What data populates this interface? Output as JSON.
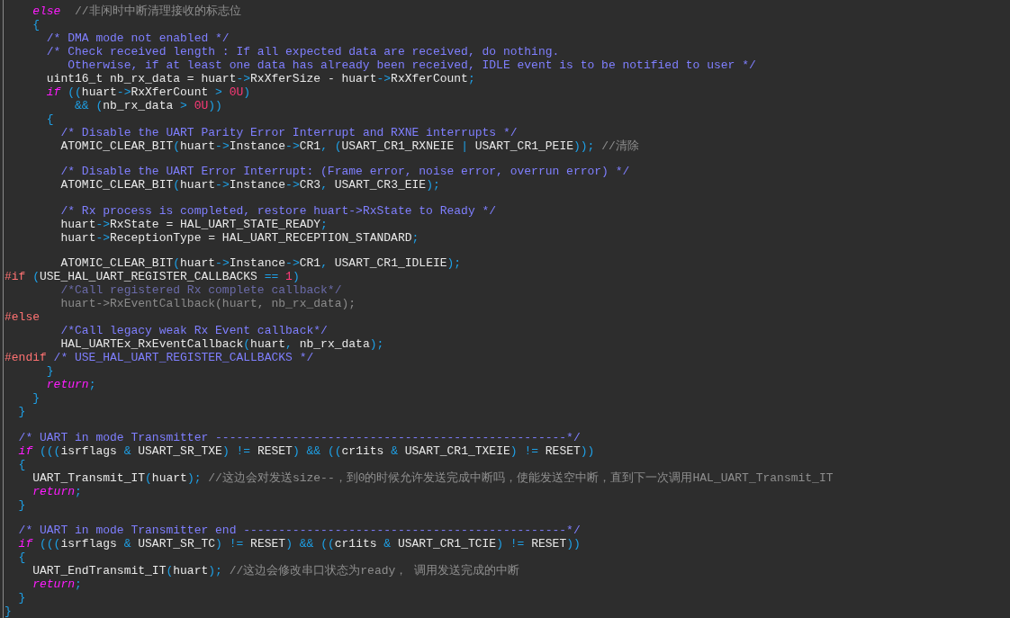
{
  "editor": {
    "lines": [
      {
        "kind": "code",
        "tokens": [
          {
            "kind": "keyword",
            "text": "    else"
          },
          {
            "kind": "note",
            "text": "  //非闲时中断清理接收的标志位"
          }
        ]
      },
      {
        "kind": "code",
        "tokens": [
          {
            "kind": "punct",
            "text": "    {"
          }
        ]
      },
      {
        "kind": "code",
        "tokens": [
          {
            "kind": "comment",
            "text": "      /* DMA mode not enabled */"
          }
        ]
      },
      {
        "kind": "code",
        "tokens": [
          {
            "kind": "comment",
            "text": "      /* Check received length : If all expected data are received, do nothing."
          }
        ]
      },
      {
        "kind": "code",
        "tokens": [
          {
            "kind": "comment",
            "text": "         Otherwise, if at least one data has already been received, IDLE event is to be notified to user */"
          }
        ]
      },
      {
        "kind": "code",
        "tokens": [
          {
            "kind": "plain",
            "text": "      uint16_t nb_rx_data = huart"
          },
          {
            "kind": "punct",
            "text": "->"
          },
          {
            "kind": "plain",
            "text": "RxXferSize - huart"
          },
          {
            "kind": "punct",
            "text": "->"
          },
          {
            "kind": "plain",
            "text": "RxXferCount"
          },
          {
            "kind": "punct",
            "text": ";"
          }
        ]
      },
      {
        "kind": "code",
        "tokens": [
          {
            "kind": "keyword",
            "text": "      if"
          },
          {
            "kind": "punct",
            "text": " (("
          },
          {
            "kind": "plain",
            "text": "huart"
          },
          {
            "kind": "punct",
            "text": "->"
          },
          {
            "kind": "plain",
            "text": "RxXferCount "
          },
          {
            "kind": "punct",
            "text": ">"
          },
          {
            "kind": "number",
            "text": " 0U"
          },
          {
            "kind": "punct",
            "text": ")"
          }
        ]
      },
      {
        "kind": "code",
        "tokens": [
          {
            "kind": "punct",
            "text": "          && ("
          },
          {
            "kind": "plain",
            "text": "nb_rx_data "
          },
          {
            "kind": "punct",
            "text": ">"
          },
          {
            "kind": "number",
            "text": " 0U"
          },
          {
            "kind": "punct",
            "text": "))"
          }
        ]
      },
      {
        "kind": "code",
        "tokens": [
          {
            "kind": "punct",
            "text": "      {"
          }
        ]
      },
      {
        "kind": "code",
        "tokens": [
          {
            "kind": "comment",
            "text": "        /* Disable the UART Parity Error Interrupt and RXNE interrupts */"
          }
        ]
      },
      {
        "kind": "code",
        "tokens": [
          {
            "kind": "plain",
            "text": "        ATOMIC_CLEAR_BIT"
          },
          {
            "kind": "punct",
            "text": "("
          },
          {
            "kind": "plain",
            "text": "huart"
          },
          {
            "kind": "punct",
            "text": "->"
          },
          {
            "kind": "plain",
            "text": "Instance"
          },
          {
            "kind": "punct",
            "text": "->"
          },
          {
            "kind": "plain",
            "text": "CR1"
          },
          {
            "kind": "punct",
            "text": ", ("
          },
          {
            "kind": "plain",
            "text": "USART_CR1_RXNEIE "
          },
          {
            "kind": "punct",
            "text": "|"
          },
          {
            "kind": "plain",
            "text": " USART_CR1_PEIE"
          },
          {
            "kind": "punct",
            "text": "));"
          },
          {
            "kind": "note",
            "text": " //清除"
          }
        ]
      },
      {
        "kind": "blank"
      },
      {
        "kind": "code",
        "tokens": [
          {
            "kind": "comment",
            "text": "        /* Disable the UART Error Interrupt: (Frame error, noise error, overrun error) */"
          }
        ]
      },
      {
        "kind": "code",
        "tokens": [
          {
            "kind": "plain",
            "text": "        ATOMIC_CLEAR_BIT"
          },
          {
            "kind": "punct",
            "text": "("
          },
          {
            "kind": "plain",
            "text": "huart"
          },
          {
            "kind": "punct",
            "text": "->"
          },
          {
            "kind": "plain",
            "text": "Instance"
          },
          {
            "kind": "punct",
            "text": "->"
          },
          {
            "kind": "plain",
            "text": "CR3"
          },
          {
            "kind": "punct",
            "text": ", "
          },
          {
            "kind": "plain",
            "text": "USART_CR3_EIE"
          },
          {
            "kind": "punct",
            "text": ");"
          }
        ]
      },
      {
        "kind": "blank"
      },
      {
        "kind": "code",
        "tokens": [
          {
            "kind": "comment",
            "text": "        /* Rx process is completed, restore huart->RxState to Ready */"
          }
        ]
      },
      {
        "kind": "code",
        "tokens": [
          {
            "kind": "plain",
            "text": "        huart"
          },
          {
            "kind": "punct",
            "text": "->"
          },
          {
            "kind": "plain",
            "text": "RxState = HAL_UART_STATE_READY"
          },
          {
            "kind": "punct",
            "text": ";"
          }
        ]
      },
      {
        "kind": "code",
        "tokens": [
          {
            "kind": "plain",
            "text": "        huart"
          },
          {
            "kind": "punct",
            "text": "->"
          },
          {
            "kind": "plain",
            "text": "ReceptionType = HAL_UART_RECEPTION_STANDARD"
          },
          {
            "kind": "punct",
            "text": ";"
          }
        ]
      },
      {
        "kind": "blank"
      },
      {
        "kind": "code",
        "tokens": [
          {
            "kind": "plain",
            "text": "        ATOMIC_CLEAR_BIT"
          },
          {
            "kind": "punct",
            "text": "("
          },
          {
            "kind": "plain",
            "text": "huart"
          },
          {
            "kind": "punct",
            "text": "->"
          },
          {
            "kind": "plain",
            "text": "Instance"
          },
          {
            "kind": "punct",
            "text": "->"
          },
          {
            "kind": "plain",
            "text": "CR1"
          },
          {
            "kind": "punct",
            "text": ", "
          },
          {
            "kind": "plain",
            "text": "USART_CR1_IDLEIE"
          },
          {
            "kind": "punct",
            "text": ");"
          }
        ]
      },
      {
        "kind": "code",
        "tokens": [
          {
            "kind": "directive",
            "text": "#if"
          },
          {
            "kind": "punct",
            "text": " ("
          },
          {
            "kind": "plain",
            "text": "USE_HAL_UART_REGISTER_CALLBACKS "
          },
          {
            "kind": "punct",
            "text": "=="
          },
          {
            "kind": "number",
            "text": " 1"
          },
          {
            "kind": "punct",
            "text": ")"
          }
        ]
      },
      {
        "kind": "code",
        "tokens": [
          {
            "kind": "inactive_comment",
            "text": "        /*Call registered Rx complete callback*/"
          }
        ]
      },
      {
        "kind": "code",
        "tokens": [
          {
            "kind": "inactive",
            "text": "        huart->RxEventCallback(huart, nb_rx_data);"
          }
        ]
      },
      {
        "kind": "code",
        "tokens": [
          {
            "kind": "directive",
            "text": "#else"
          }
        ]
      },
      {
        "kind": "code",
        "tokens": [
          {
            "kind": "comment",
            "text": "        /*Call legacy weak Rx Event callback*/"
          }
        ]
      },
      {
        "kind": "code",
        "tokens": [
          {
            "kind": "plain",
            "text": "        HAL_UARTEx_RxEventCallback"
          },
          {
            "kind": "punct",
            "text": "("
          },
          {
            "kind": "plain",
            "text": "huart"
          },
          {
            "kind": "punct",
            "text": ","
          },
          {
            "kind": "plain",
            "text": " nb_rx_data"
          },
          {
            "kind": "punct",
            "text": ");"
          }
        ]
      },
      {
        "kind": "code",
        "tokens": [
          {
            "kind": "directive",
            "text": "#endif"
          },
          {
            "kind": "comment",
            "text": " /* USE_HAL_UART_REGISTER_CALLBACKS */"
          }
        ]
      },
      {
        "kind": "code",
        "tokens": [
          {
            "kind": "punct",
            "text": "      }"
          }
        ]
      },
      {
        "kind": "code",
        "tokens": [
          {
            "kind": "keyword",
            "text": "      return"
          },
          {
            "kind": "punct",
            "text": ";"
          }
        ]
      },
      {
        "kind": "code",
        "tokens": [
          {
            "kind": "punct",
            "text": "    }"
          }
        ]
      },
      {
        "kind": "code",
        "tokens": [
          {
            "kind": "punct",
            "text": "  }"
          }
        ]
      },
      {
        "kind": "blank"
      },
      {
        "kind": "code",
        "tokens": [
          {
            "kind": "comment",
            "text": "  /* UART in mode Transmitter --------------------------------------------------*/"
          }
        ]
      },
      {
        "kind": "code",
        "tokens": [
          {
            "kind": "keyword",
            "text": "  if"
          },
          {
            "kind": "punct",
            "text": " ((("
          },
          {
            "kind": "plain",
            "text": "isrflags "
          },
          {
            "kind": "punct",
            "text": "&"
          },
          {
            "kind": "plain",
            "text": " USART_SR_TXE"
          },
          {
            "kind": "punct",
            "text": ") !="
          },
          {
            "kind": "plain",
            "text": " RESET"
          },
          {
            "kind": "punct",
            "text": ") && (("
          },
          {
            "kind": "plain",
            "text": "cr1its "
          },
          {
            "kind": "punct",
            "text": "&"
          },
          {
            "kind": "plain",
            "text": " USART_CR1_TXEIE"
          },
          {
            "kind": "punct",
            "text": ") !="
          },
          {
            "kind": "plain",
            "text": " RESET"
          },
          {
            "kind": "punct",
            "text": "))"
          }
        ]
      },
      {
        "kind": "code",
        "tokens": [
          {
            "kind": "punct",
            "text": "  {"
          }
        ]
      },
      {
        "kind": "code",
        "tokens": [
          {
            "kind": "plain",
            "text": "    UART_Transmit_IT"
          },
          {
            "kind": "punct",
            "text": "("
          },
          {
            "kind": "plain",
            "text": "huart"
          },
          {
            "kind": "punct",
            "text": ");"
          },
          {
            "kind": "note",
            "text": " //这边会对发送size--，到0的时候允许发送完成中断吗，使能发送空中断，直到下一次调用HAL_UART_Transmit_IT"
          }
        ]
      },
      {
        "kind": "code",
        "tokens": [
          {
            "kind": "keyword",
            "text": "    return"
          },
          {
            "kind": "punct",
            "text": ";"
          }
        ]
      },
      {
        "kind": "code",
        "tokens": [
          {
            "kind": "punct",
            "text": "  }"
          }
        ]
      },
      {
        "kind": "blank"
      },
      {
        "kind": "code",
        "tokens": [
          {
            "kind": "comment",
            "text": "  /* UART in mode Transmitter end ----------------------------------------------*/"
          }
        ]
      },
      {
        "kind": "code",
        "tokens": [
          {
            "kind": "keyword",
            "text": "  if"
          },
          {
            "kind": "punct",
            "text": " ((("
          },
          {
            "kind": "plain",
            "text": "isrflags "
          },
          {
            "kind": "punct",
            "text": "&"
          },
          {
            "kind": "plain",
            "text": " USART_SR_TC"
          },
          {
            "kind": "punct",
            "text": ") !="
          },
          {
            "kind": "plain",
            "text": " RESET"
          },
          {
            "kind": "punct",
            "text": ") && (("
          },
          {
            "kind": "plain",
            "text": "cr1its "
          },
          {
            "kind": "punct",
            "text": "&"
          },
          {
            "kind": "plain",
            "text": " USART_CR1_TCIE"
          },
          {
            "kind": "punct",
            "text": ") !="
          },
          {
            "kind": "plain",
            "text": " RESET"
          },
          {
            "kind": "punct",
            "text": "))"
          }
        ]
      },
      {
        "kind": "code",
        "tokens": [
          {
            "kind": "punct",
            "text": "  {"
          }
        ]
      },
      {
        "kind": "code",
        "tokens": [
          {
            "kind": "plain",
            "text": "    UART_EndTransmit_IT"
          },
          {
            "kind": "punct",
            "text": "("
          },
          {
            "kind": "plain",
            "text": "huart"
          },
          {
            "kind": "punct",
            "text": ");"
          },
          {
            "kind": "note",
            "text": " //这边会修改串口状态为ready， 调用发送完成的中断"
          }
        ]
      },
      {
        "kind": "code",
        "tokens": [
          {
            "kind": "keyword",
            "text": "    return"
          },
          {
            "kind": "punct",
            "text": ";"
          }
        ]
      },
      {
        "kind": "code",
        "tokens": [
          {
            "kind": "punct",
            "text": "  }"
          }
        ]
      },
      {
        "kind": "code",
        "tokens": [
          {
            "kind": "punct",
            "text": "}"
          }
        ]
      }
    ]
  }
}
